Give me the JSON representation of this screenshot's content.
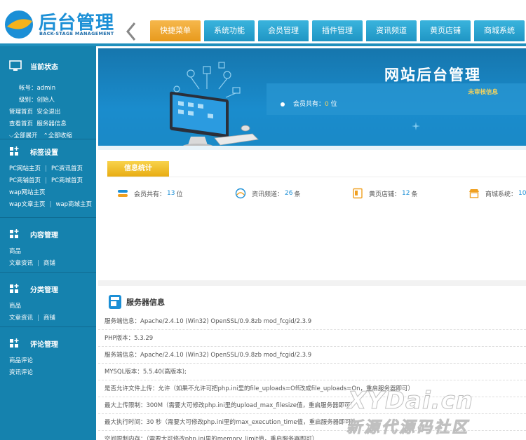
{
  "logo": {
    "title": "后台管理",
    "subtitle": "BACK-STAGE MANAGEMENT"
  },
  "nav": [
    {
      "label": "快捷菜单",
      "active": true
    },
    {
      "label": "系统功能"
    },
    {
      "label": "会员管理"
    },
    {
      "label": "插件管理"
    },
    {
      "label": "资讯频道"
    },
    {
      "label": "黄页店铺"
    },
    {
      "label": "商城系统"
    }
  ],
  "sidebar": {
    "status": {
      "heading": "当前状态",
      "account_label": "帐号：",
      "account": "admin",
      "level_label": "级别：",
      "level": "创始人",
      "links1": [
        "管理首页",
        "安全退出"
      ],
      "links2": [
        "查看首页",
        "服务器信息"
      ],
      "links3": [
        "全部展开",
        "全部收缩"
      ]
    },
    "tags": {
      "heading": "标签设置",
      "rows": [
        [
          "PC网站主页",
          "PC资讯首页"
        ],
        [
          "PC商铺首页",
          "PC商城首页"
        ],
        [
          "wap网站主页"
        ],
        [
          "wap文章主页",
          "wap商城主页"
        ]
      ]
    },
    "content": {
      "heading": "内容管理",
      "rows": [
        [
          "商品"
        ],
        [
          "文章资讯",
          "商铺"
        ]
      ]
    },
    "category": {
      "heading": "分类管理",
      "rows": [
        [
          "商品"
        ],
        [
          "文章资讯",
          "商铺"
        ]
      ]
    },
    "comments": {
      "heading": "评论管理",
      "rows": [
        [
          "商品评论"
        ],
        [
          "资讯评论"
        ]
      ]
    }
  },
  "banner": {
    "title": "网站后台管理",
    "pending": "未审核信息",
    "member_label": "会员共有：",
    "member_count": "0",
    "member_unit": " 位"
  },
  "stats": {
    "tag": "信息统计",
    "items": [
      {
        "label": "会员共有：",
        "value": "13",
        "unit": " 位"
      },
      {
        "label": "资讯频道：",
        "value": "26",
        "unit": " 条"
      },
      {
        "label": "黄页店铺：",
        "value": "12",
        "unit": " 条"
      },
      {
        "label": "商城系统：",
        "value": "10",
        "unit": ""
      }
    ]
  },
  "server": {
    "title": "服务器信息",
    "rows": [
      "服务端信息：Apache/2.4.10 (Win32) OpenSSL/0.9.8zb mod_fcgid/2.3.9",
      "PHP版本：5.3.29",
      "服务端信息：Apache/2.4.10 (Win32) OpenSSL/0.9.8zb mod_fcgid/2.3.9",
      "MYSQL版本：5.5.40(高版本);",
      "是否允许文件上传：允许（如果不允许可把php.ini里的file_uploads=Off改成file_uploads=On，重启服务器即可）",
      "最大上传限制：300M（需要大可修改php.ini里的upload_max_filesize值，重启服务器即可）",
      "最大执行时间：30 秒（需要大可修改php.ini里的max_execution_time值，重启服务器即可）",
      "空间限制内存：（需要大可修改php.ini里的memory_limit值，重启服务器即可）"
    ]
  },
  "watermark": {
    "line1": "XYDai.cn",
    "line2": "新源代源码社区"
  }
}
